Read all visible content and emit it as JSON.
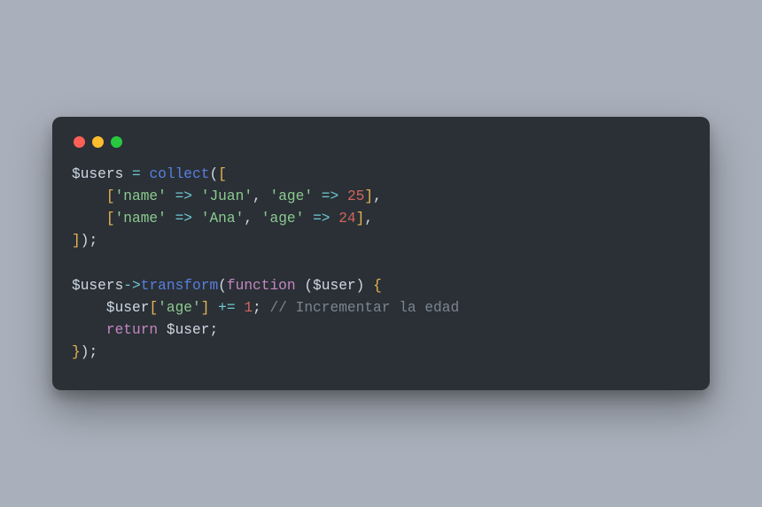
{
  "window": {
    "dots": [
      "red",
      "yellow",
      "green"
    ]
  },
  "code": {
    "tokens": [
      [
        {
          "t": "$users",
          "c": "var"
        },
        {
          "t": " ",
          "c": "default"
        },
        {
          "t": "=",
          "c": "op"
        },
        {
          "t": " ",
          "c": "default"
        },
        {
          "t": "collect",
          "c": "func"
        },
        {
          "t": "(",
          "c": "punct"
        },
        {
          "t": "[",
          "c": "bracket"
        }
      ],
      [
        {
          "t": "    ",
          "c": "default"
        },
        {
          "t": "[",
          "c": "bracket"
        },
        {
          "t": "'name'",
          "c": "string"
        },
        {
          "t": " ",
          "c": "default"
        },
        {
          "t": "=>",
          "c": "op"
        },
        {
          "t": " ",
          "c": "default"
        },
        {
          "t": "'Juan'",
          "c": "string"
        },
        {
          "t": ",",
          "c": "punct"
        },
        {
          "t": " ",
          "c": "default"
        },
        {
          "t": "'age'",
          "c": "string"
        },
        {
          "t": " ",
          "c": "default"
        },
        {
          "t": "=>",
          "c": "op"
        },
        {
          "t": " ",
          "c": "default"
        },
        {
          "t": "25",
          "c": "number"
        },
        {
          "t": "]",
          "c": "bracket"
        },
        {
          "t": ",",
          "c": "punct"
        }
      ],
      [
        {
          "t": "    ",
          "c": "default"
        },
        {
          "t": "[",
          "c": "bracket"
        },
        {
          "t": "'name'",
          "c": "string"
        },
        {
          "t": " ",
          "c": "default"
        },
        {
          "t": "=>",
          "c": "op"
        },
        {
          "t": " ",
          "c": "default"
        },
        {
          "t": "'Ana'",
          "c": "string"
        },
        {
          "t": ",",
          "c": "punct"
        },
        {
          "t": " ",
          "c": "default"
        },
        {
          "t": "'age'",
          "c": "string"
        },
        {
          "t": " ",
          "c": "default"
        },
        {
          "t": "=>",
          "c": "op"
        },
        {
          "t": " ",
          "c": "default"
        },
        {
          "t": "24",
          "c": "number"
        },
        {
          "t": "]",
          "c": "bracket"
        },
        {
          "t": ",",
          "c": "punct"
        }
      ],
      [
        {
          "t": "]",
          "c": "bracket"
        },
        {
          "t": ")",
          "c": "punct"
        },
        {
          "t": ";",
          "c": "punct"
        }
      ],
      [],
      [
        {
          "t": "$users",
          "c": "var"
        },
        {
          "t": "->",
          "c": "op"
        },
        {
          "t": "transform",
          "c": "func"
        },
        {
          "t": "(",
          "c": "punct"
        },
        {
          "t": "function",
          "c": "keyword"
        },
        {
          "t": " ",
          "c": "default"
        },
        {
          "t": "(",
          "c": "punct"
        },
        {
          "t": "$user",
          "c": "var"
        },
        {
          "t": ")",
          "c": "punct"
        },
        {
          "t": " ",
          "c": "default"
        },
        {
          "t": "{",
          "c": "bracket"
        }
      ],
      [
        {
          "t": "    ",
          "c": "default"
        },
        {
          "t": "$user",
          "c": "var"
        },
        {
          "t": "[",
          "c": "bracket"
        },
        {
          "t": "'age'",
          "c": "string"
        },
        {
          "t": "]",
          "c": "bracket"
        },
        {
          "t": " ",
          "c": "default"
        },
        {
          "t": "+=",
          "c": "op"
        },
        {
          "t": " ",
          "c": "default"
        },
        {
          "t": "1",
          "c": "number"
        },
        {
          "t": ";",
          "c": "punct"
        },
        {
          "t": " ",
          "c": "default"
        },
        {
          "t": "// Incrementar la edad",
          "c": "comment"
        }
      ],
      [
        {
          "t": "    ",
          "c": "default"
        },
        {
          "t": "return",
          "c": "keyword"
        },
        {
          "t": " ",
          "c": "default"
        },
        {
          "t": "$user",
          "c": "var"
        },
        {
          "t": ";",
          "c": "punct"
        }
      ],
      [
        {
          "t": "}",
          "c": "bracket"
        },
        {
          "t": ")",
          "c": "punct"
        },
        {
          "t": ";",
          "c": "punct"
        }
      ]
    ]
  }
}
